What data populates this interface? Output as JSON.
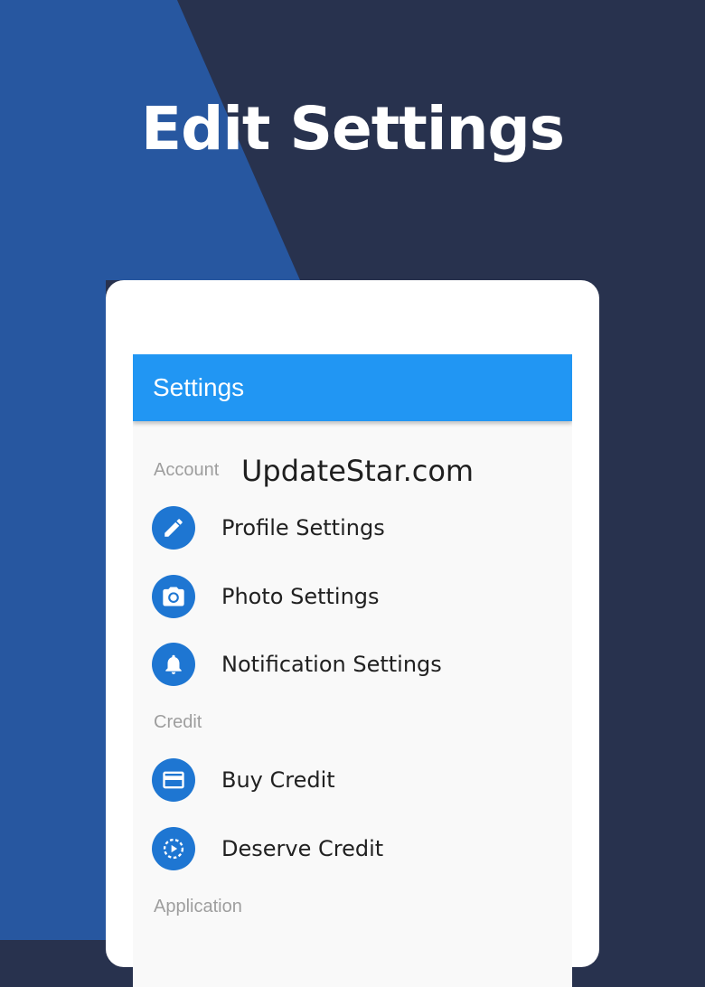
{
  "headline": "Edit Settings",
  "watermark": "UpdateStar.com",
  "colors": {
    "background_dark": "#28324e",
    "background_blue": "#2757a0",
    "appbar": "#2196f3",
    "icon_circle": "#1e76d2"
  },
  "appbar": {
    "title": "Settings"
  },
  "sections": [
    {
      "header": "Account",
      "items": [
        {
          "label": "Profile Settings",
          "icon": "pencil-icon"
        },
        {
          "label": "Photo Settings",
          "icon": "camera-icon"
        },
        {
          "label": "Notification Settings",
          "icon": "bell-icon"
        }
      ]
    },
    {
      "header": "Credit",
      "items": [
        {
          "label": "Buy Credit",
          "icon": "credit-card-icon"
        },
        {
          "label": "Deserve Credit",
          "icon": "play-circle-icon"
        }
      ]
    },
    {
      "header": "Application",
      "items": []
    }
  ]
}
